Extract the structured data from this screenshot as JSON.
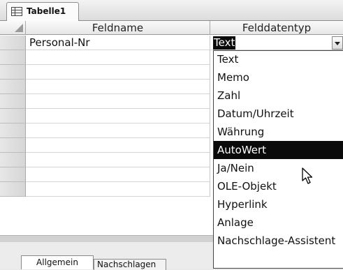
{
  "document_tab": {
    "label": "Tabelle1",
    "icon": "table-icon"
  },
  "grid": {
    "columns": [
      "Feldname",
      "Felddatentyp"
    ],
    "rows": [
      {
        "field_name": "Personal-Nr",
        "data_type": "Text"
      }
    ],
    "empty_rows": 10
  },
  "dropdown": {
    "options": [
      "Text",
      "Memo",
      "Zahl",
      "Datum/Uhrzeit",
      "Währung",
      "AutoWert",
      "Ja/Nein",
      "OLE-Objekt",
      "Hyperlink",
      "Anlage",
      "Nachschlage-Assistent"
    ],
    "highlighted_index": 5
  },
  "property_tabs": [
    "Allgemein",
    "Nachschlagen"
  ],
  "cursor_icon": "mouse-pointer-icon",
  "colors": {
    "selection": "#0a0a0a",
    "header": "#e6e6e6",
    "background": "#e9e9e9"
  }
}
